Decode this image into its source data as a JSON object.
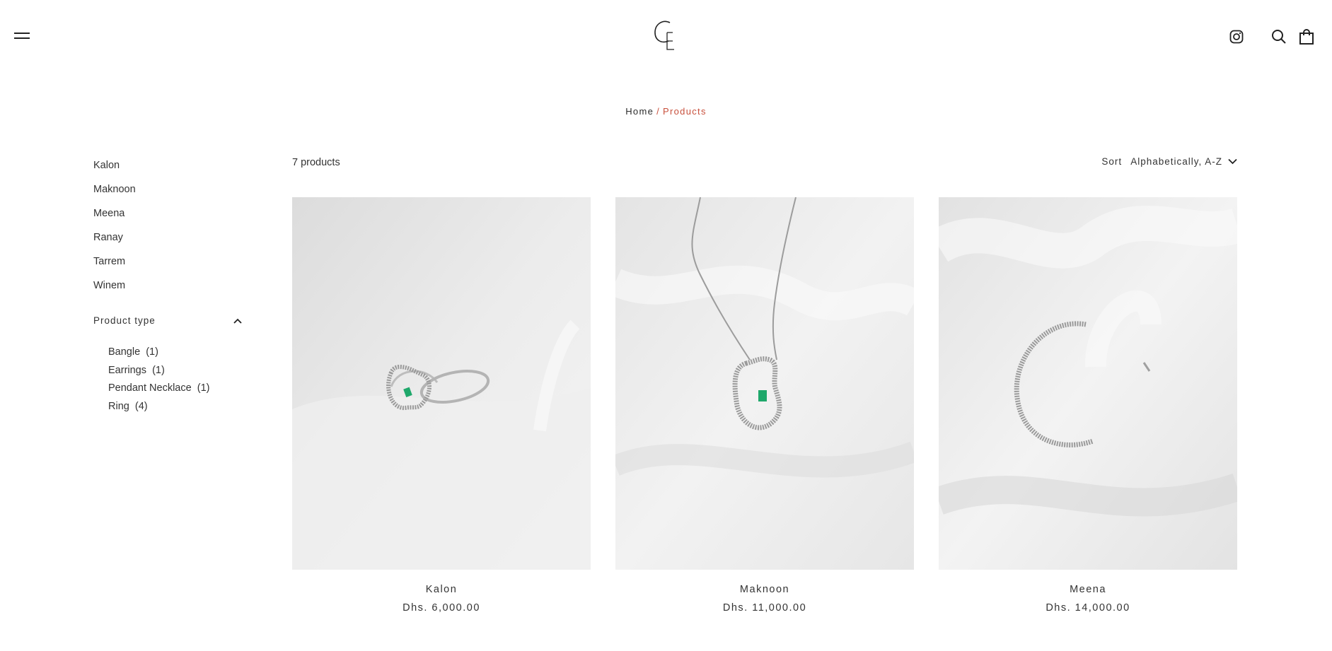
{
  "header": {
    "logo_text": "CE",
    "icons": [
      "menu-icon",
      "instagram-icon",
      "search-icon",
      "bag-icon"
    ]
  },
  "breadcrumb": {
    "home": "Home",
    "separator": "/",
    "current": "Products"
  },
  "sidebar": {
    "collections": [
      "Kalon",
      "Maknoon",
      "Meena",
      "Ranay",
      "Tarrem",
      "Winem"
    ],
    "filter_title": "Product type",
    "filters": [
      {
        "label": "Bangle",
        "count": "(1)"
      },
      {
        "label": "Earrings",
        "count": "(1)"
      },
      {
        "label": "Pendant Necklace",
        "count": "(1)"
      },
      {
        "label": "Ring",
        "count": "(4)"
      }
    ]
  },
  "toolbar": {
    "count": "7 products",
    "sort_label": "Sort",
    "sort_value": "Alphabetically, A-Z"
  },
  "products": [
    {
      "name": "Kalon",
      "price": "Dhs. 6,000.00"
    },
    {
      "name": "Maknoon",
      "price": "Dhs. 11,000.00"
    },
    {
      "name": "Meena",
      "price": "Dhs. 14,000.00"
    }
  ],
  "colors": {
    "accent": "#c8503c",
    "text": "#2b2b2b",
    "emerald": "#1fa86b"
  }
}
